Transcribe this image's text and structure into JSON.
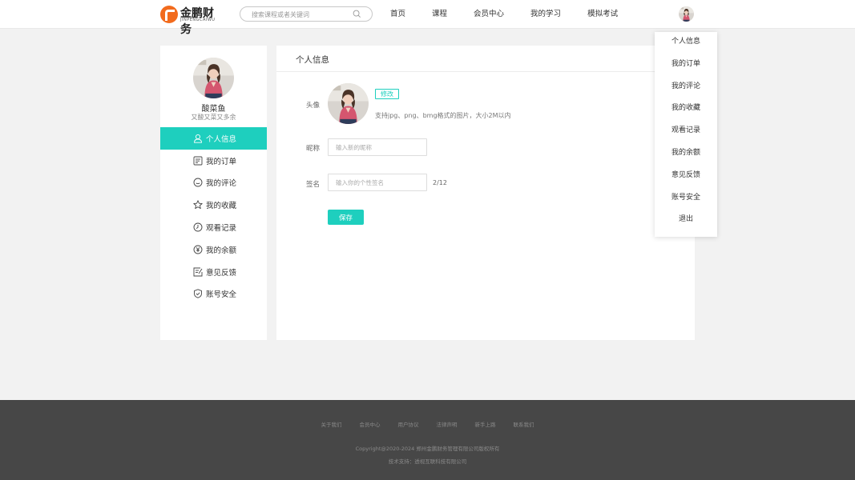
{
  "brand": {
    "name": "金鹏财务",
    "sub": "JINPENGCAIWU",
    "accent": "#1ecfbe",
    "logo_color": "#f26b1d"
  },
  "search": {
    "placeholder": "搜索课程或者关键词",
    "value": "",
    "icon": "search-icon"
  },
  "nav": {
    "items": [
      {
        "label": "首页"
      },
      {
        "label": "课程"
      },
      {
        "label": "会员中心"
      },
      {
        "label": "我的学习"
      },
      {
        "label": "模拟考试"
      }
    ]
  },
  "dropdown": {
    "items": [
      {
        "label": "个人信息"
      },
      {
        "label": "我的订单"
      },
      {
        "label": "我的评论"
      },
      {
        "label": "我的收藏"
      },
      {
        "label": "观看记录"
      },
      {
        "label": "我的余额"
      },
      {
        "label": "意见反馈"
      },
      {
        "label": "账号安全"
      },
      {
        "label": "退出"
      }
    ]
  },
  "profile": {
    "name": "酸菜鱼",
    "signature": "又酸又菜又多余"
  },
  "sidebar": {
    "items": [
      {
        "label": "个人信息",
        "icon": "user-icon",
        "active": true
      },
      {
        "label": "我的订单",
        "icon": "order-icon",
        "active": false
      },
      {
        "label": "我的评论",
        "icon": "comment-icon",
        "active": false
      },
      {
        "label": "我的收藏",
        "icon": "star-icon",
        "active": false
      },
      {
        "label": "观看记录",
        "icon": "clock-icon",
        "active": false
      },
      {
        "label": "我的余额",
        "icon": "yen-icon",
        "active": false
      },
      {
        "label": "意见反馈",
        "icon": "feedback-icon",
        "active": false
      },
      {
        "label": "账号安全",
        "icon": "shield-icon",
        "active": false
      }
    ]
  },
  "main": {
    "title": "个人信息",
    "avatar_label": "头像",
    "edit_label": "修改",
    "avatar_hint": "支持jpg、png、bmg格式的图片，大小2M以内",
    "nickname_label": "昵称",
    "nickname_placeholder": "输入新的昵称",
    "signature_label": "签名",
    "signature_placeholder": "输入你的个性签名",
    "signature_counter": "2/12",
    "save_label": "保存"
  },
  "footer": {
    "links": [
      {
        "label": "关于我们"
      },
      {
        "label": "会员中心"
      },
      {
        "label": "用户协议"
      },
      {
        "label": "法律声明"
      },
      {
        "label": "新手上路"
      },
      {
        "label": "联系我们"
      }
    ],
    "copyright": "Copyright@2020-2024 郑州金鹏财务管理有限公司版权所有",
    "tech": "技术支持：透视互联科技有限公司"
  }
}
